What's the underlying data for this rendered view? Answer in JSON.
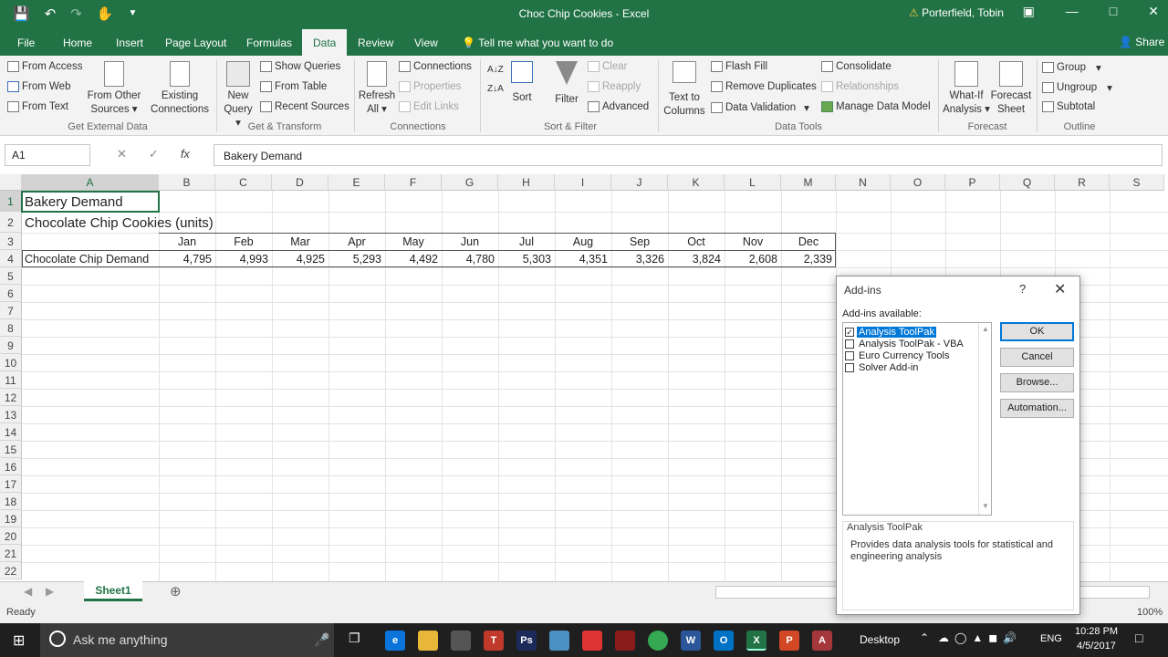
{
  "titlebar": {
    "title": "Choc Chip Cookies  -  Excel",
    "user": "Porterfield, Tobin"
  },
  "tabs": [
    {
      "label": "File"
    },
    {
      "label": "Home"
    },
    {
      "label": "Insert"
    },
    {
      "label": "Page Layout"
    },
    {
      "label": "Formulas"
    },
    {
      "label": "Data"
    },
    {
      "label": "Review"
    },
    {
      "label": "View"
    }
  ],
  "tellme": "Tell me what you want to do",
  "share": "Share",
  "ribbon": {
    "groups": {
      "get_external": "Get External Data",
      "get_transform": "Get & Transform",
      "connections": "Connections",
      "sort_filter": "Sort & Filter",
      "data_tools": "Data Tools",
      "forecast": "Forecast",
      "outline": "Outline"
    },
    "from_access": "From Access",
    "from_web": "From Web",
    "from_text": "From Text",
    "from_other_1": "From Other",
    "from_other_2": "Sources",
    "existing_1": "Existing",
    "existing_2": "Connections",
    "new_query_1": "New",
    "new_query_2": "Query",
    "show_queries": "Show Queries",
    "from_table": "From Table",
    "recent_sources": "Recent Sources",
    "refresh_1": "Refresh",
    "refresh_2": "All",
    "connections": "Connections",
    "properties": "Properties",
    "edit_links": "Edit Links",
    "sort": "Sort",
    "filter": "Filter",
    "clear": "Clear",
    "reapply": "Reapply",
    "advanced": "Advanced",
    "text_to_1": "Text to",
    "text_to_2": "Columns",
    "flash_fill": "Flash Fill",
    "remove_duplicates": "Remove Duplicates",
    "data_validation": "Data Validation",
    "consolidate": "Consolidate",
    "relationships": "Relationships",
    "manage_model": "Manage Data Model",
    "whatif_1": "What-If",
    "whatif_2": "Analysis",
    "forecast_1": "Forecast",
    "forecast_2": "Sheet",
    "group": "Group",
    "ungroup": "Ungroup",
    "subtotal": "Subtotal"
  },
  "formula_bar": {
    "name_box": "A1",
    "content": "Bakery Demand"
  },
  "grid": {
    "columns": [
      "A",
      "B",
      "C",
      "D",
      "E",
      "F",
      "G",
      "H",
      "I",
      "J",
      "K",
      "L",
      "M",
      "N",
      "O",
      "P",
      "Q",
      "R",
      "S"
    ],
    "rows": [
      "1",
      "2",
      "3",
      "4",
      "5",
      "6",
      "7",
      "8",
      "9",
      "10",
      "11",
      "12",
      "13",
      "14",
      "15",
      "16",
      "17",
      "18",
      "19",
      "20",
      "21",
      "22"
    ],
    "a1": "Bakery Demand",
    "a2": "Chocolate Chip Cookies (units)",
    "months": [
      "Jan",
      "Feb",
      "Mar",
      "Apr",
      "May",
      "Jun",
      "Jul",
      "Aug",
      "Sep",
      "Oct",
      "Nov",
      "Dec"
    ],
    "a4": "Chocolate Chip Demand",
    "demand": [
      "4,795",
      "4,993",
      "4,925",
      "5,293",
      "4,492",
      "4,780",
      "5,303",
      "4,351",
      "3,326",
      "3,824",
      "2,608",
      "2,339"
    ]
  },
  "sheet_tab": "Sheet1",
  "status": "Ready",
  "zoom": "100%",
  "dialog": {
    "title": "Add-ins",
    "help": "?",
    "list_label": "Add-ins available:",
    "items": [
      {
        "label": "Analysis ToolPak",
        "checked": true
      },
      {
        "label": "Analysis ToolPak - VBA",
        "checked": false
      },
      {
        "label": "Euro Currency Tools",
        "checked": false
      },
      {
        "label": "Solver Add-in",
        "checked": false
      }
    ],
    "ok": "OK",
    "cancel": "Cancel",
    "browse": "Browse...",
    "automation": "Automation...",
    "desc_title": "Analysis ToolPak",
    "desc_text": "Provides data analysis tools for statistical and engineering analysis"
  },
  "taskbar": {
    "search": "Ask me anything",
    "desktop": "Desktop",
    "lang": "ENG",
    "time": "10:28 PM",
    "date": "4/5/2017"
  }
}
